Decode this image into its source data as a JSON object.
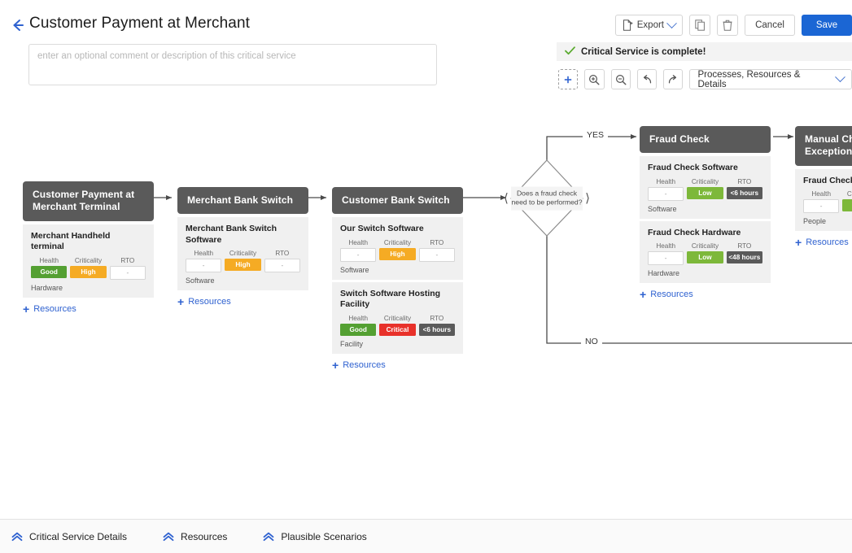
{
  "header": {
    "back_icon": "back-arrow-icon",
    "title": "Customer Payment at Merchant",
    "comment_placeholder": "enter an optional comment or description of this critical service",
    "comment_value": ""
  },
  "toolbar": {
    "export_label": "Export",
    "export_icon": "export-file-icon",
    "export_caret_icon": "chevron-down-icon",
    "copy_icon": "copy-icon",
    "delete_icon": "trash-icon",
    "cancel_label": "Cancel",
    "save_label": "Save",
    "save_color": "#1b66d4"
  },
  "status_banner": {
    "check_icon": "check-icon",
    "text": "Critical Service is complete!",
    "icon_color": "#5aaa2e",
    "background": "#f3f3f3"
  },
  "diagram_toolbar": {
    "fit_icon": "fit-to-screen-icon",
    "zoom_in_icon": "zoom-in-icon",
    "zoom_out_icon": "zoom-out-icon",
    "undo_icon": "undo-icon",
    "redo_icon": "redo-icon",
    "view_select_label": "Processes, Resources & Details",
    "view_select_caret_icon": "chevron-down-icon"
  },
  "colors": {
    "node_header": "#5a5a5a",
    "good": "#54a032",
    "high": "#f5ab24",
    "critical": "#e8312a",
    "low": "#7db83a",
    "rto": "#5a5a5a",
    "link": "#2f62d0"
  },
  "diagram": {
    "add_resources_label": "Resources",
    "metric_labels": {
      "health": "Health",
      "criticality": "Criticality",
      "rto": "RTO"
    },
    "branch_yes": "YES",
    "branch_no": "NO",
    "nodes": [
      {
        "id": "customer-payment-terminal",
        "title": "Customer Payment at Merchant Terminal",
        "resources": [
          {
            "name": "Merchant Handheld terminal",
            "health": "Good",
            "health_state": "good",
            "criticality": "High",
            "criticality_state": "high",
            "rto": "-",
            "rto_state": "empty",
            "type": "Hardware"
          }
        ]
      },
      {
        "id": "merchant-bank-switch",
        "title": "Merchant Bank Switch",
        "resources": [
          {
            "name": "Merchant Bank Switch Software",
            "health": "-",
            "health_state": "empty",
            "criticality": "High",
            "criticality_state": "high",
            "rto": "-",
            "rto_state": "empty",
            "type": "Software"
          }
        ]
      },
      {
        "id": "customer-bank-switch",
        "title": "Customer Bank Switch",
        "resources": [
          {
            "name": "Our Switch Software",
            "health": "-",
            "health_state": "empty",
            "criticality": "High",
            "criticality_state": "high",
            "rto": "-",
            "rto_state": "empty",
            "type": "Software"
          },
          {
            "name": "Switch Software Hosting Facility",
            "health": "Good",
            "health_state": "good",
            "criticality": "Critical",
            "criticality_state": "critical",
            "rto": "<6 hours",
            "rto_state": "rto",
            "type": "Facility"
          }
        ]
      },
      {
        "id": "fraud-check",
        "title": "Fraud Check",
        "resources": [
          {
            "name": "Fraud Check Software",
            "health": "-",
            "health_state": "empty",
            "criticality": "Low",
            "criticality_state": "low",
            "rto": "<6 hours",
            "rto_state": "rto",
            "type": "Software"
          },
          {
            "name": "Fraud Check Hardware",
            "health": "-",
            "health_state": "empty",
            "criticality": "Low",
            "criticality_state": "low",
            "rto": "<48 hours",
            "rto_state": "rto",
            "type": "Hardware"
          }
        ]
      },
      {
        "id": "manual-check-exceptions",
        "title": "Manual Check Exceptions R",
        "resources": [
          {
            "name": "Fraud Check Te Office",
            "health": "-",
            "health_state": "empty",
            "criticality": "Cri",
            "criticality_state": "low",
            "rto": "",
            "rto_state": "hidden",
            "type": "People"
          }
        ]
      }
    ],
    "decision": {
      "id": "fraud-check-decision",
      "text": "Does a fraud check need to be performed?",
      "left_handle_icon": "chevron-left-icon",
      "right_handle_icon": "chevron-right-icon"
    }
  },
  "bottom_bar": {
    "items": [
      {
        "label": "Critical Service Details",
        "icon": "chevron-double-up-icon"
      },
      {
        "label": "Resources",
        "icon": "chevron-double-up-icon"
      },
      {
        "label": "Plausible Scenarios",
        "icon": "chevron-double-up-icon"
      }
    ]
  }
}
